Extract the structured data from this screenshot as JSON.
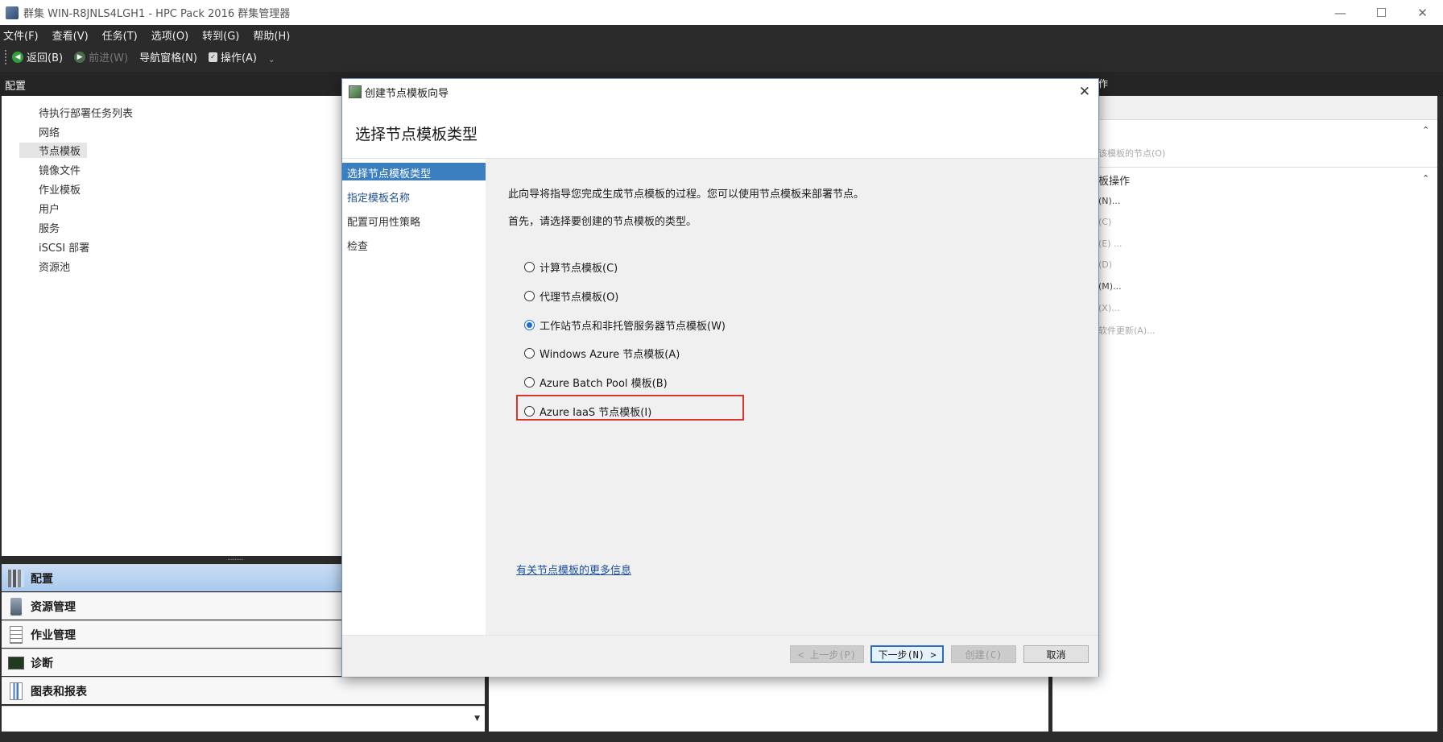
{
  "window": {
    "title": "群集 WIN-R8JNLS4LGH1 - HPC Pack 2016 群集管理器",
    "minimize": "—",
    "maximize": "☐",
    "close": "✕"
  },
  "menu": [
    "文件(F)",
    "查看(V)",
    "任务(T)",
    "选项(O)",
    "转到(G)",
    "帮助(H)"
  ],
  "toolbar": {
    "back": "返回(B)",
    "forward": "前进(W)",
    "nav_pane": "导航窗格(N)",
    "actions": "操作(A)",
    "overflow": "⌄"
  },
  "left_panel": {
    "header": "配置",
    "items": [
      "待执行部署任务列表",
      "网络",
      "节点模板",
      "镜像文件",
      "作业模板",
      "用户",
      "服务",
      "iSCSI 部署",
      "资源池"
    ],
    "selected_index": 2,
    "splitter": "·········"
  },
  "nav_buttons": [
    "配置",
    "资源管理",
    "作业管理",
    "诊断",
    "图表和报表"
  ],
  "nav_footer_arrow": "▼",
  "right_panel": {
    "header_fragment": "作",
    "rows": [
      "该模板的节点(O)",
      "板操作",
      "(N)...",
      "(C)",
      "(E) ...",
      "(D)",
      "(M)...",
      "(X)...",
      "软件更新(A)..."
    ],
    "collapse_glyph": "⌃"
  },
  "dialog": {
    "title": "创建节点模板向导",
    "close": "✕",
    "heading": "选择节点模板类型",
    "steps": [
      "选择节点模板类型",
      "指定模板名称",
      "配置可用性策略",
      "检查"
    ],
    "current_step": 0,
    "intro_line1": "此向导将指导您完成生成节点模板的过程。您可以使用节点模板来部署节点。",
    "intro_line2": "首先，请选择要创建的节点模板的类型。",
    "options": [
      "计算节点模板(C)",
      "代理节点模板(O)",
      "工作站节点和非托管服务器节点模板(W)",
      "Windows Azure 节点模板(A)",
      "Azure Batch Pool 模板(B)",
      "Azure IaaS 节点模板(I)"
    ],
    "selected_option": 2,
    "more_info_link": "有关节点模板的更多信息",
    "buttons": {
      "prev": "< 上一步(P)",
      "next": "下一步(N) >",
      "create": "创建(C)",
      "cancel": "取消"
    }
  },
  "colors": {
    "accent": "#3c7fc1",
    "highlight_border": "#d9342b",
    "chrome_dark": "#2b2b2b"
  }
}
